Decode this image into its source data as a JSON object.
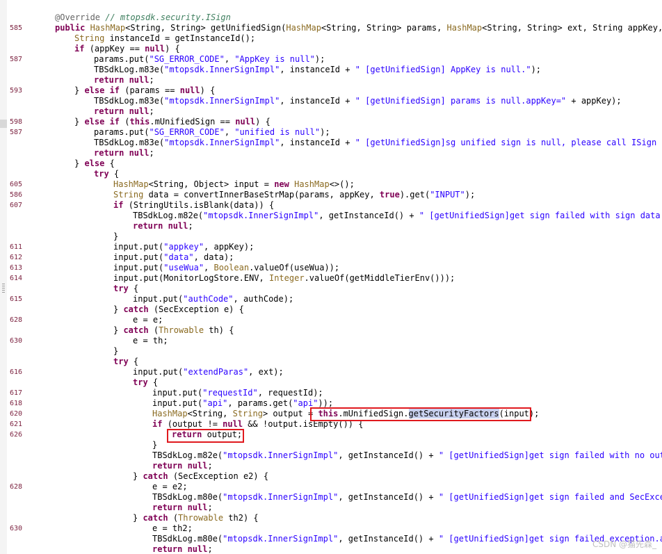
{
  "lines": [
    {
      "n": "",
      "i": 0,
      "t": [
        [
          "ann",
          "@Override "
        ],
        [
          "cmt",
          "// mtopsdk.security.ISign"
        ]
      ]
    },
    {
      "n": "585",
      "i": 0,
      "t": [
        [
          "kw",
          "public "
        ],
        [
          "cls",
          "HashMap"
        ],
        [
          "",
          "<String, String> getUnifiedSign("
        ],
        [
          "cls",
          "HashMap"
        ],
        [
          "",
          "<String, String> params, "
        ],
        [
          "cls",
          "HashMap"
        ],
        [
          "",
          "<String, String> ext, String appKey, Str"
        ]
      ]
    },
    {
      "n": "",
      "i": 1,
      "t": [
        [
          "cls",
          "String"
        ],
        [
          "",
          " instanceId = getInstanceId();"
        ]
      ]
    },
    {
      "n": "",
      "i": 1,
      "t": [
        [
          "kw",
          "if "
        ],
        [
          "",
          "(appKey == "
        ],
        [
          "kw",
          "null"
        ],
        [
          "",
          ") {"
        ]
      ]
    },
    {
      "n": "587",
      "i": 2,
      "t": [
        [
          "",
          "params.put("
        ],
        [
          "str",
          "\"SG_ERROR_CODE\""
        ],
        [
          "",
          ", "
        ],
        [
          "str",
          "\"AppKey is null\""
        ],
        [
          "",
          ");"
        ]
      ]
    },
    {
      "n": "",
      "i": 2,
      "t": [
        [
          "",
          "TBSdkLog.m83e("
        ],
        [
          "str",
          "\"mtopsdk.InnerSignImpl\""
        ],
        [
          "",
          ", instanceId + "
        ],
        [
          "str",
          "\" [getUnifiedSign] AppKey is null.\""
        ],
        [
          "",
          ");"
        ]
      ]
    },
    {
      "n": "",
      "i": 2,
      "t": [
        [
          "kw",
          "return null"
        ],
        [
          "",
          ";"
        ]
      ]
    },
    {
      "n": "593",
      "i": 1,
      "t": [
        [
          "",
          "} "
        ],
        [
          "kw",
          "else if "
        ],
        [
          "",
          "(params == "
        ],
        [
          "kw",
          "null"
        ],
        [
          "",
          ") {"
        ]
      ]
    },
    {
      "n": "",
      "i": 2,
      "t": [
        [
          "",
          "TBSdkLog.m83e("
        ],
        [
          "str",
          "\"mtopsdk.InnerSignImpl\""
        ],
        [
          "",
          ", instanceId + "
        ],
        [
          "str",
          "\" [getUnifiedSign] params is null.appKey=\""
        ],
        [
          "",
          " + appKey);"
        ]
      ]
    },
    {
      "n": "",
      "i": 2,
      "t": [
        [
          "kw",
          "return null"
        ],
        [
          "",
          ";"
        ]
      ]
    },
    {
      "n": "598",
      "i": 1,
      "t": [
        [
          "",
          "} "
        ],
        [
          "kw",
          "else if "
        ],
        [
          "",
          "("
        ],
        [
          "kw",
          "this"
        ],
        [
          "",
          ".mUnifiedSign == "
        ],
        [
          "kw",
          "null"
        ],
        [
          "",
          ") {"
        ]
      ]
    },
    {
      "n": "587",
      "i": 2,
      "t": [
        [
          "",
          "params.put("
        ],
        [
          "str",
          "\"SG_ERROR_CODE\""
        ],
        [
          "",
          ", "
        ],
        [
          "str",
          "\"unified is null\""
        ],
        [
          "",
          ");"
        ]
      ]
    },
    {
      "n": "",
      "i": 2,
      "t": [
        [
          "",
          "TBSdkLog.m83e("
        ],
        [
          "str",
          "\"mtopsdk.InnerSignImpl\""
        ],
        [
          "",
          ", instanceId + "
        ],
        [
          "str",
          "\" [getUnifiedSign]sg unified sign is null, please call ISign init"
        ]
      ]
    },
    {
      "n": "",
      "i": 2,
      "t": [
        [
          "kw",
          "return null"
        ],
        [
          "",
          ";"
        ]
      ]
    },
    {
      "n": "",
      "i": 1,
      "t": [
        [
          "",
          "} "
        ],
        [
          "kw",
          "else "
        ],
        [
          "",
          "{"
        ]
      ]
    },
    {
      "n": "",
      "i": 2,
      "t": [
        [
          "kw",
          "try "
        ],
        [
          "",
          "{"
        ]
      ]
    },
    {
      "n": "605",
      "i": 3,
      "t": [
        [
          "cls",
          "HashMap"
        ],
        [
          "",
          "<String, Object> input = "
        ],
        [
          "kw",
          "new "
        ],
        [
          "cls",
          "HashMap"
        ],
        [
          "",
          "<>();"
        ]
      ]
    },
    {
      "n": "586",
      "i": 3,
      "t": [
        [
          "cls",
          "String"
        ],
        [
          "",
          "",
          " data = convertInnerBaseStrMap(params, appKey, "
        ],
        [
          "kw",
          "true"
        ],
        [
          "",
          ").get("
        ],
        [
          "str",
          "\"INPUT\""
        ],
        [
          "",
          ");"
        ]
      ]
    },
    {
      "n": "607",
      "i": 3,
      "t": [
        [
          "kw",
          "if "
        ],
        [
          "",
          "(StringUtils.isBlank(data)) {"
        ]
      ]
    },
    {
      "n": "",
      "i": 4,
      "t": [
        [
          "",
          "TBSdkLog.m82e("
        ],
        [
          "str",
          "\"mtopsdk.InnerSignImpl\""
        ],
        [
          "",
          ", getInstanceId() + "
        ],
        [
          "str",
          "\" [getUnifiedSign]get sign failed with sign data emp"
        ]
      ]
    },
    {
      "n": "",
      "i": 4,
      "t": [
        [
          "kw",
          "return null"
        ],
        [
          "",
          ";"
        ]
      ]
    },
    {
      "n": "",
      "i": 3,
      "t": [
        [
          "",
          "}"
        ]
      ]
    },
    {
      "n": "611",
      "i": 3,
      "t": [
        [
          "",
          "input.put("
        ],
        [
          "str",
          "\"appkey\""
        ],
        [
          "",
          ", appKey);"
        ]
      ]
    },
    {
      "n": "612",
      "i": 3,
      "t": [
        [
          "",
          "input.put("
        ],
        [
          "str",
          "\"data\""
        ],
        [
          "",
          ", data);"
        ]
      ]
    },
    {
      "n": "613",
      "i": 3,
      "t": [
        [
          "",
          "input.put("
        ],
        [
          "str",
          "\"useWua\""
        ],
        [
          "",
          ", "
        ],
        [
          "cls",
          "Boolean"
        ],
        [
          "",
          ".valueOf(useWua));"
        ]
      ]
    },
    {
      "n": "614",
      "i": 3,
      "t": [
        [
          "",
          "input.put(MonitorLogStore.ENV, "
        ],
        [
          "cls",
          "Integer"
        ],
        [
          "",
          ".valueOf(getMiddleTierEnv()));"
        ]
      ]
    },
    {
      "n": "",
      "i": 3,
      "t": [
        [
          "kw",
          "try "
        ],
        [
          "",
          "{"
        ]
      ]
    },
    {
      "n": "615",
      "i": 4,
      "t": [
        [
          "",
          "input.put("
        ],
        [
          "str",
          "\"authCode\""
        ],
        [
          "",
          ", authCode);"
        ]
      ]
    },
    {
      "n": "",
      "i": 3,
      "t": [
        [
          "",
          "} "
        ],
        [
          "kw",
          "catch "
        ],
        [
          "",
          "(SecException e) {"
        ]
      ]
    },
    {
      "n": "628",
      "i": 4,
      "t": [
        [
          "",
          "e = e;"
        ]
      ]
    },
    {
      "n": "",
      "i": 3,
      "t": [
        [
          "",
          "} "
        ],
        [
          "kw",
          "catch "
        ],
        [
          "",
          "("
        ],
        [
          "cls",
          "Throwable"
        ],
        [
          "",
          " th) {"
        ]
      ]
    },
    {
      "n": "630",
      "i": 4,
      "t": [
        [
          "",
          "e = th;"
        ]
      ]
    },
    {
      "n": "",
      "i": 3,
      "t": [
        [
          "",
          "}"
        ]
      ]
    },
    {
      "n": "",
      "i": 3,
      "t": [
        [
          "kw",
          "try "
        ],
        [
          "",
          "{"
        ]
      ]
    },
    {
      "n": "616",
      "i": 4,
      "t": [
        [
          "",
          "input.put("
        ],
        [
          "str",
          "\"extendParas\""
        ],
        [
          "",
          ", ext);"
        ]
      ]
    },
    {
      "n": "",
      "i": 4,
      "t": [
        [
          "kw",
          "try "
        ],
        [
          "",
          "{"
        ]
      ]
    },
    {
      "n": "617",
      "i": 5,
      "t": [
        [
          "",
          "input.put("
        ],
        [
          "str",
          "\"requestId\""
        ],
        [
          "",
          ", requestId);"
        ]
      ]
    },
    {
      "n": "618",
      "i": 5,
      "t": [
        [
          "",
          "input.put("
        ],
        [
          "str",
          "\"api\""
        ],
        [
          "",
          ", params.get("
        ],
        [
          "str",
          "\"api\""
        ],
        [
          "",
          "));"
        ]
      ]
    },
    {
      "n": "620",
      "i": 5,
      "t": [
        [
          "cls",
          "HashMap"
        ],
        [
          "",
          "<String, "
        ],
        [
          "cls",
          "String"
        ],
        [
          "",
          "> output = "
        ],
        [
          "kw",
          "this"
        ],
        [
          "",
          ".mUnifiedSign."
        ],
        [
          "sel",
          "getSecurityFactors"
        ],
        [
          "",
          "(input);"
        ]
      ]
    },
    {
      "n": "621",
      "i": 5,
      "t": [
        [
          "kw",
          "if "
        ],
        [
          "",
          "(output != "
        ],
        [
          "kw",
          "null "
        ],
        [
          "",
          "&& !output.isEmpty()) {"
        ]
      ]
    },
    {
      "n": "626",
      "i": 6,
      "t": [
        [
          "kw",
          "return "
        ],
        [
          "",
          "output;"
        ]
      ]
    },
    {
      "n": "",
      "i": 5,
      "t": [
        [
          "",
          "}"
        ]
      ]
    },
    {
      "n": "",
      "i": 5,
      "t": [
        [
          "",
          "TBSdkLog.m82e("
        ],
        [
          "str",
          "\"mtopsdk.InnerSignImpl\""
        ],
        [
          "",
          ", getInstanceId() + "
        ],
        [
          "str",
          "\" [getUnifiedSign]get sign failed with no output"
        ]
      ]
    },
    {
      "n": "",
      "i": 5,
      "t": [
        [
          "kw",
          "return null"
        ],
        [
          "",
          ";"
        ]
      ]
    },
    {
      "n": "",
      "i": 4,
      "t": [
        [
          "",
          "} "
        ],
        [
          "kw",
          "catch "
        ],
        [
          "",
          "(SecException e2) {"
        ]
      ]
    },
    {
      "n": "628",
      "i": 5,
      "t": [
        [
          "",
          "e = e2;"
        ]
      ]
    },
    {
      "n": "",
      "i": 5,
      "t": [
        [
          "",
          "TBSdkLog.m80e("
        ],
        [
          "str",
          "\"mtopsdk.InnerSignImpl\""
        ],
        [
          "",
          ", getInstanceId() + "
        ],
        [
          "str",
          "\" [getUnifiedSign]get sign failed and SecExcepti"
        ]
      ]
    },
    {
      "n": "",
      "i": 5,
      "t": [
        [
          "kw",
          "return null"
        ],
        [
          "",
          ";"
        ]
      ]
    },
    {
      "n": "",
      "i": 4,
      "t": [
        [
          "",
          "} "
        ],
        [
          "kw",
          "catch "
        ],
        [
          "",
          "("
        ],
        [
          "cls",
          "Throwable"
        ],
        [
          "",
          " th2) {"
        ]
      ]
    },
    {
      "n": "630",
      "i": 5,
      "t": [
        [
          "",
          "e = th2;"
        ]
      ]
    },
    {
      "n": "",
      "i": 5,
      "t": [
        [
          "",
          "TBSdkLog.m80e("
        ],
        [
          "str",
          "\"mtopsdk.InnerSignImpl\""
        ],
        [
          "",
          ", getInstanceId() + "
        ],
        [
          "str",
          "\" [getUnifiedSign]get sign failed exception.app"
        ]
      ]
    },
    {
      "n": "",
      "i": 5,
      "t": [
        [
          "kw",
          "return null"
        ],
        [
          "",
          ";"
        ]
      ]
    }
  ],
  "watermark": "CSDN @猫先森_"
}
